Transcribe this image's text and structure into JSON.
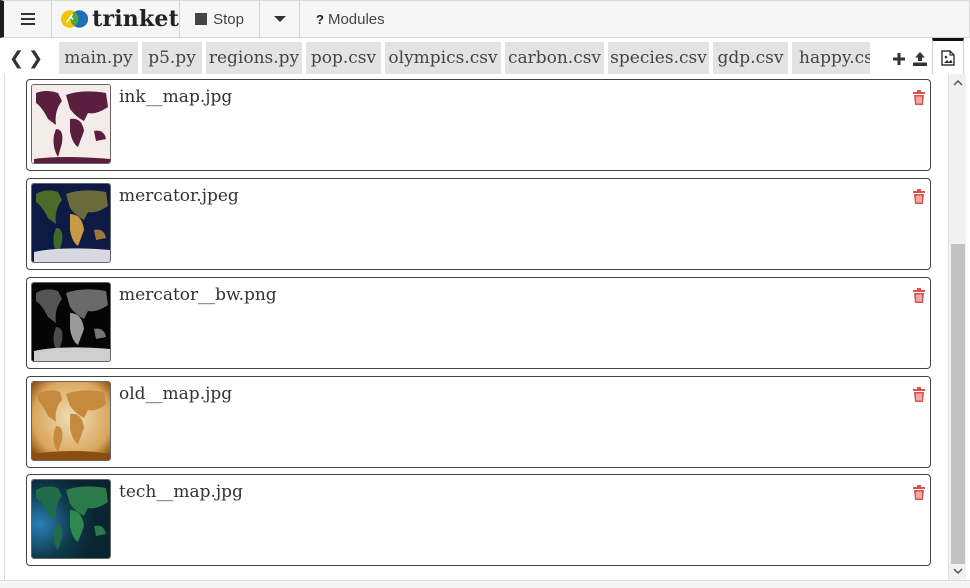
{
  "header": {
    "brand": "trinket",
    "stop_label": "Stop",
    "modules_label": "Modules",
    "help_glyph": "?"
  },
  "tabs": [
    {
      "label": "main.py"
    },
    {
      "label": "p5.py"
    },
    {
      "label": "regions.py"
    },
    {
      "label": "pop.csv"
    },
    {
      "label": "olympics.csv"
    },
    {
      "label": "carbon.csv"
    },
    {
      "label": "species.csv"
    },
    {
      "label": "gdp.csv"
    },
    {
      "label": "happy.cs"
    }
  ],
  "files": [
    {
      "name": "ink__map.jpg"
    },
    {
      "name": "mercator.jpeg"
    },
    {
      "name": "mercator__bw.png"
    },
    {
      "name": "old__map.jpg"
    },
    {
      "name": "tech__map.jpg"
    }
  ],
  "icons": {
    "menu": "hamburger-icon",
    "prev": "chevron-left-icon",
    "next": "chevron-right-icon",
    "add": "plus-icon",
    "upload": "upload-icon",
    "images": "image-icon",
    "delete": "trash-icon"
  },
  "colors": {
    "delete_icon": "#d9534f",
    "tab_bg": "#e3e3e3",
    "logo_yellow": "#f2c500",
    "logo_blue": "#1d6fb8",
    "logo_green": "#4aa83f"
  }
}
